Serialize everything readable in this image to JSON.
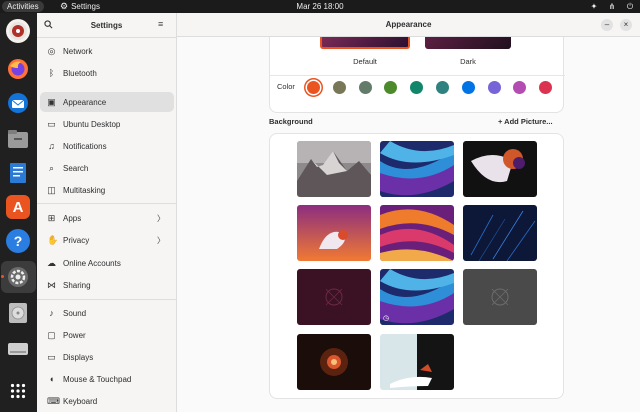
{
  "topbar": {
    "activities": "Activities",
    "app_name": "Settings",
    "clock": "Mar 26  18:00"
  },
  "dock": {
    "items": [
      {
        "name": "rhythmbox-icon"
      },
      {
        "name": "firefox-icon"
      },
      {
        "name": "thunderbird-icon"
      },
      {
        "name": "files-icon"
      },
      {
        "name": "libreoffice-writer-icon"
      },
      {
        "name": "app-center-icon"
      },
      {
        "name": "help-icon"
      },
      {
        "name": "settings-icon"
      },
      {
        "name": "disc-icon"
      },
      {
        "name": "drive-icon"
      },
      {
        "name": "show-apps-icon"
      }
    ]
  },
  "sidebar": {
    "title": "Settings",
    "items": [
      {
        "label": "Network",
        "icon": "network-icon"
      },
      {
        "label": "Bluetooth",
        "icon": "bluetooth-icon"
      },
      {
        "label": "Appearance",
        "icon": "appearance-icon",
        "active": true
      },
      {
        "label": "Ubuntu Desktop",
        "icon": "ubuntu-desktop-icon"
      },
      {
        "label": "Notifications",
        "icon": "bell-icon"
      },
      {
        "label": "Search",
        "icon": "search-icon"
      },
      {
        "label": "Multitasking",
        "icon": "multitasking-icon"
      },
      {
        "label": "Apps",
        "icon": "apps-icon",
        "chevron": true
      },
      {
        "label": "Privacy",
        "icon": "privacy-icon",
        "chevron": true
      },
      {
        "label": "Online Accounts",
        "icon": "online-accounts-icon"
      },
      {
        "label": "Sharing",
        "icon": "sharing-icon"
      },
      {
        "label": "Sound",
        "icon": "sound-icon"
      },
      {
        "label": "Power",
        "icon": "power-icon"
      },
      {
        "label": "Displays",
        "icon": "display-icon"
      },
      {
        "label": "Mouse & Touchpad",
        "icon": "mouse-icon"
      },
      {
        "label": "Keyboard",
        "icon": "keyboard-icon"
      }
    ]
  },
  "main": {
    "title": "Appearance",
    "style": {
      "default_label": "Default",
      "dark_label": "Dark"
    },
    "color_label": "Color",
    "colors": [
      "#e95420",
      "#787859",
      "#657b69",
      "#4c8a2b",
      "#12866a",
      "#308280",
      "#0073e5",
      "#7764d8",
      "#b34cb3",
      "#da3450"
    ],
    "selected_color": "#e95420",
    "background_title": "Background",
    "add_picture_label": "+ Add Picture..."
  }
}
